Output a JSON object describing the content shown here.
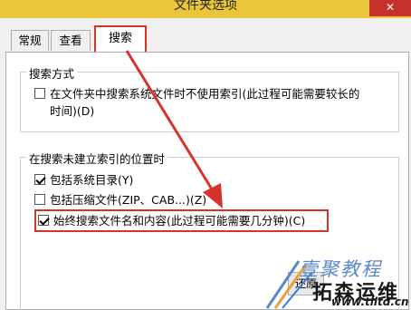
{
  "window": {
    "title": "文件夹选项",
    "close_label": "✕"
  },
  "tabs": [
    {
      "label": "常规"
    },
    {
      "label": "查看"
    },
    {
      "label": "搜索"
    }
  ],
  "search_method": {
    "legend": "搜索方式",
    "option_line1": "在文件夹中搜索系统文件时不使用索引(此过程可能需要较长的",
    "option_line2": "时间)(D)",
    "option_checked": false
  },
  "non_indexed": {
    "legend": "在搜索未建立索引的位置时",
    "options": [
      {
        "label": "包括系统目录(Y)",
        "checked": true
      },
      {
        "label": "包括压缩文件(ZIP、CAB...)(Z)",
        "checked": false
      },
      {
        "label": "始终搜索文件名和内容(此过程可能需要几分钟)(C)",
        "checked": true
      }
    ]
  },
  "restore_button": {
    "label": "还原"
  },
  "watermark": {
    "line1": "壹聚教程",
    "line2": "拓森运维",
    "url": "www.tlltd.cn"
  },
  "colors": {
    "annotation_red": "#d6332b",
    "titlebar": "#e9c63a",
    "watermark_blue": "#5b88c9"
  }
}
